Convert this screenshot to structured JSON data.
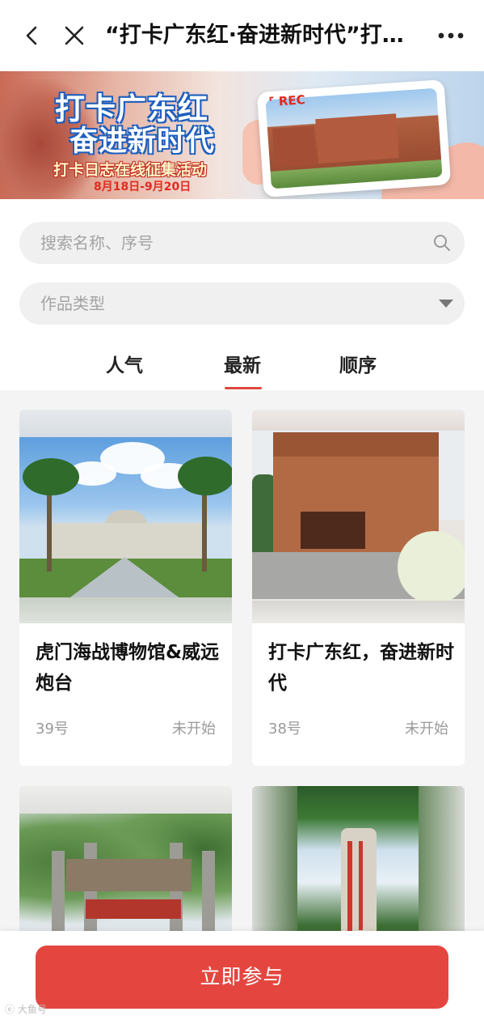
{
  "topbar": {
    "title": "“打卡广东红·奋进新时代”打…"
  },
  "banner": {
    "title_line1": "打卡广东红",
    "title_line2": "奋进新时代",
    "subtitle": "打卡日志在线征集活动",
    "date_range": "8月18日-9月20日",
    "rec_label": "REC"
  },
  "filters": {
    "search_placeholder": "搜索名称、序号",
    "type_placeholder": "作品类型"
  },
  "tabs": [
    {
      "label": "人气"
    },
    {
      "label": "最新"
    },
    {
      "label": "顺序"
    }
  ],
  "active_tab": "最新",
  "cards": [
    {
      "title": "虎门海战博物馆&威远炮台",
      "number": "39号",
      "status": "未开始"
    },
    {
      "title": "打卡广东红，奋进新时代",
      "number": "38号",
      "status": "未开始"
    },
    {
      "title": "",
      "number": "",
      "status": ""
    },
    {
      "title": "",
      "number": "",
      "status": ""
    }
  ],
  "footer": {
    "join_label": "立即参与",
    "watermark": "大鱼号"
  },
  "colors": {
    "accent": "#e4463f",
    "tab_underline": "#e0483e",
    "muted_text": "#9a9a9a"
  },
  "icons": {
    "back": "back-icon",
    "close": "close-icon",
    "more": "more-icon",
    "search": "search-icon",
    "dropdown": "dropdown-arrow-icon"
  }
}
